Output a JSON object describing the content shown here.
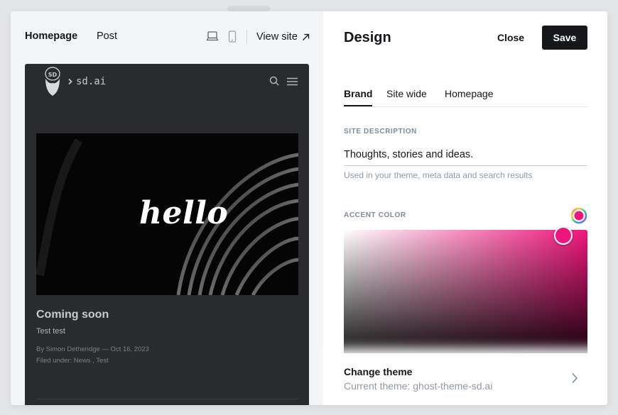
{
  "preview": {
    "tabs": [
      {
        "label": "Homepage",
        "active": true
      },
      {
        "label": "Post",
        "active": false
      }
    ],
    "device_icons": [
      "desktop-icon",
      "mobile-icon"
    ],
    "view_site_label": "View site",
    "blog": {
      "site_name": "sd.ai",
      "logo_text": "SD",
      "hero_word": "hello",
      "post_title": "Coming soon",
      "post_excerpt": "Test test",
      "post_meta": "By Simon Detheridge — Oct 16, 2023",
      "post_tags": "Filed under: News , Test"
    }
  },
  "settings": {
    "title": "Design",
    "close_label": "Close",
    "save_label": "Save",
    "tabs": [
      {
        "label": "Brand",
        "active": true
      },
      {
        "label": "Site wide",
        "active": false
      },
      {
        "label": "Homepage",
        "active": false
      }
    ],
    "site_description": {
      "label": "SITE DESCRIPTION",
      "value": "Thoughts, stories and ideas.",
      "hint": "Used in your theme, meta data and search results"
    },
    "accent_color": {
      "label": "ACCENT COLOR",
      "value": "#f0157c"
    },
    "change_theme": {
      "title": "Change theme",
      "current": "Current theme: ghost-theme-sd.ai"
    }
  }
}
